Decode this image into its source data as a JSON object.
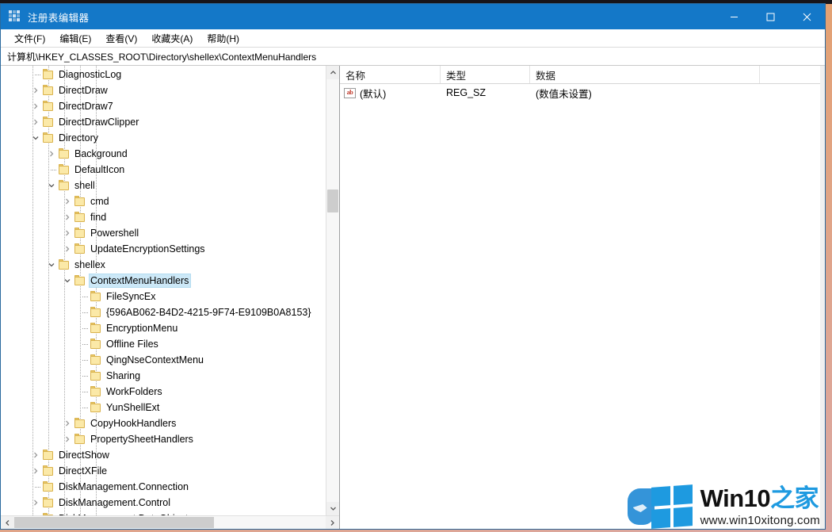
{
  "window": {
    "title": "注册表编辑器",
    "icon": "registry-icon",
    "controls": {
      "minimize": "minimize-icon",
      "maximize": "maximize-icon",
      "close": "close-icon"
    }
  },
  "menubar": {
    "items": [
      {
        "label": "文件(F)"
      },
      {
        "label": "编辑(E)"
      },
      {
        "label": "查看(V)"
      },
      {
        "label": "收藏夹(A)"
      },
      {
        "label": "帮助(H)"
      }
    ]
  },
  "addressbar": {
    "path": "计算机\\HKEY_CLASSES_ROOT\\Directory\\shellex\\ContextMenuHandlers"
  },
  "tree": {
    "nodes": [
      {
        "label": "DiagnosticLog",
        "depth": 1,
        "state": "leaf"
      },
      {
        "label": "DirectDraw",
        "depth": 1,
        "state": "collapsed"
      },
      {
        "label": "DirectDraw7",
        "depth": 1,
        "state": "collapsed"
      },
      {
        "label": "DirectDrawClipper",
        "depth": 1,
        "state": "collapsed"
      },
      {
        "label": "Directory",
        "depth": 1,
        "state": "expanded"
      },
      {
        "label": "Background",
        "depth": 2,
        "state": "collapsed"
      },
      {
        "label": "DefaultIcon",
        "depth": 2,
        "state": "leaf"
      },
      {
        "label": "shell",
        "depth": 2,
        "state": "expanded"
      },
      {
        "label": "cmd",
        "depth": 3,
        "state": "collapsed"
      },
      {
        "label": "find",
        "depth": 3,
        "state": "collapsed"
      },
      {
        "label": "Powershell",
        "depth": 3,
        "state": "collapsed"
      },
      {
        "label": "UpdateEncryptionSettings",
        "depth": 3,
        "state": "collapsed"
      },
      {
        "label": "shellex",
        "depth": 2,
        "state": "expanded"
      },
      {
        "label": "ContextMenuHandlers",
        "depth": 3,
        "state": "expanded",
        "selected": true
      },
      {
        "label": "FileSyncEx",
        "depth": 4,
        "state": "leaf"
      },
      {
        "label": "{596AB062-B4D2-4215-9F74-E9109B0A8153}",
        "depth": 4,
        "state": "leaf"
      },
      {
        "label": "EncryptionMenu",
        "depth": 4,
        "state": "leaf"
      },
      {
        "label": "Offline Files",
        "depth": 4,
        "state": "leaf"
      },
      {
        "label": "QingNseContextMenu",
        "depth": 4,
        "state": "leaf"
      },
      {
        "label": "Sharing",
        "depth": 4,
        "state": "leaf"
      },
      {
        "label": "WorkFolders",
        "depth": 4,
        "state": "leaf"
      },
      {
        "label": "YunShellExt",
        "depth": 4,
        "state": "leaf"
      },
      {
        "label": "CopyHookHandlers",
        "depth": 3,
        "state": "collapsed"
      },
      {
        "label": "PropertySheetHandlers",
        "depth": 3,
        "state": "collapsed"
      },
      {
        "label": "DirectShow",
        "depth": 1,
        "state": "collapsed"
      },
      {
        "label": "DirectXFile",
        "depth": 1,
        "state": "collapsed"
      },
      {
        "label": "DiskManagement.Connection",
        "depth": 1,
        "state": "leaf"
      },
      {
        "label": "DiskManagement.Control",
        "depth": 1,
        "state": "collapsed"
      },
      {
        "label": "DiskManagement.DataObject",
        "depth": 1,
        "state": "collapsed"
      }
    ]
  },
  "list": {
    "columns": [
      {
        "key": "name",
        "label": "名称"
      },
      {
        "key": "type",
        "label": "类型"
      },
      {
        "key": "data",
        "label": "数据"
      }
    ],
    "rows": [
      {
        "icon": "string-value-icon",
        "name": "(默认)",
        "type": "REG_SZ",
        "data": "(数值未设置)"
      }
    ]
  },
  "watermark": {
    "brand": "Win10",
    "brand_cn": "之家",
    "url": "www.win10xitong.com",
    "logo": "windows-logo-icon",
    "bird": "bird-mascot-icon"
  },
  "colors": {
    "titlebar": "#1478c8",
    "selection": "#cce8f7",
    "folder": "#fbe9a8",
    "accent": "#1e9ae0"
  }
}
